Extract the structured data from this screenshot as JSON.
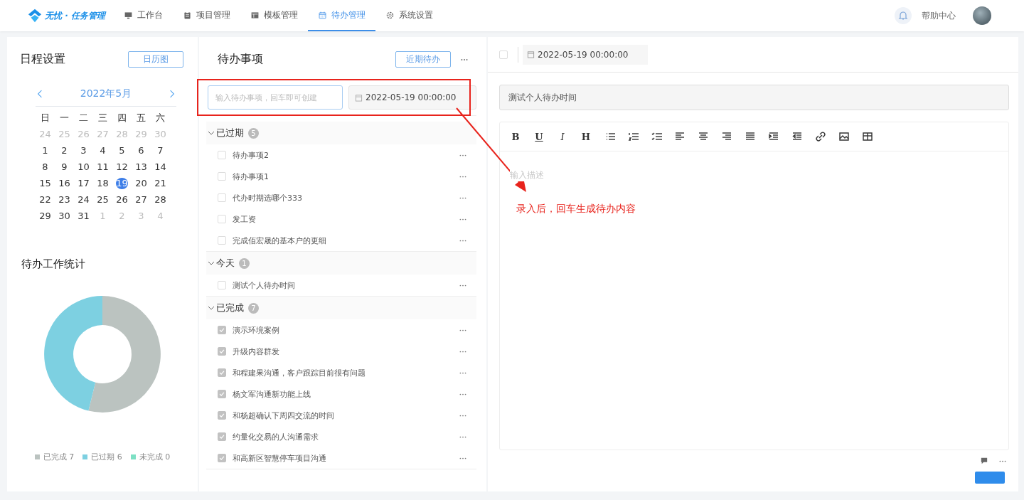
{
  "header": {
    "logo": "无忧 · 任务管理",
    "nav": [
      {
        "label": "工作台",
        "kind": "monitor",
        "selected": false
      },
      {
        "label": "项目管理",
        "kind": "clipboard",
        "selected": false
      },
      {
        "label": "模板管理",
        "kind": "layout",
        "selected": false
      },
      {
        "label": "待办管理",
        "kind": "calendar",
        "selected": true
      },
      {
        "label": "系统设置",
        "kind": "gear",
        "selected": false
      }
    ],
    "help": "帮助中心"
  },
  "schedule": {
    "title": "日程设置",
    "button": "日历图",
    "month": "2022年5月",
    "weekdays": [
      "日",
      "一",
      "二",
      "三",
      "四",
      "五",
      "六"
    ],
    "weeks": [
      [
        {
          "day": "24",
          "other_month": true,
          "selected": false
        },
        {
          "day": "25",
          "other_month": true,
          "selected": false
        },
        {
          "day": "26",
          "other_month": true,
          "selected": false
        },
        {
          "day": "27",
          "other_month": true,
          "selected": false
        },
        {
          "day": "28",
          "other_month": true,
          "selected": false
        },
        {
          "day": "29",
          "other_month": true,
          "selected": false
        },
        {
          "day": "30",
          "other_month": true,
          "selected": false
        }
      ],
      [
        {
          "day": "1",
          "other_month": false,
          "selected": false
        },
        {
          "day": "2",
          "other_month": false,
          "selected": false
        },
        {
          "day": "3",
          "other_month": false,
          "selected": false
        },
        {
          "day": "4",
          "other_month": false,
          "selected": false
        },
        {
          "day": "5",
          "other_month": false,
          "selected": false
        },
        {
          "day": "6",
          "other_month": false,
          "selected": false
        },
        {
          "day": "7",
          "other_month": false,
          "selected": false
        }
      ],
      [
        {
          "day": "8",
          "other_month": false,
          "selected": false
        },
        {
          "day": "9",
          "other_month": false,
          "selected": false
        },
        {
          "day": "10",
          "other_month": false,
          "selected": false
        },
        {
          "day": "11",
          "other_month": false,
          "selected": false
        },
        {
          "day": "12",
          "other_month": false,
          "selected": false
        },
        {
          "day": "13",
          "other_month": false,
          "selected": false
        },
        {
          "day": "14",
          "other_month": false,
          "selected": false
        }
      ],
      [
        {
          "day": "15",
          "other_month": false,
          "selected": false
        },
        {
          "day": "16",
          "other_month": false,
          "selected": false
        },
        {
          "day": "17",
          "other_month": false,
          "selected": false
        },
        {
          "day": "18",
          "other_month": false,
          "selected": false
        },
        {
          "day": "19",
          "other_month": false,
          "selected": true
        },
        {
          "day": "20",
          "other_month": false,
          "selected": false
        },
        {
          "day": "21",
          "other_month": false,
          "selected": false
        }
      ],
      [
        {
          "day": "22",
          "other_month": false,
          "selected": false
        },
        {
          "day": "23",
          "other_month": false,
          "selected": false
        },
        {
          "day": "24",
          "other_month": false,
          "selected": false
        },
        {
          "day": "25",
          "other_month": false,
          "selected": false
        },
        {
          "day": "26",
          "other_month": false,
          "selected": false
        },
        {
          "day": "27",
          "other_month": false,
          "selected": false
        },
        {
          "day": "28",
          "other_month": false,
          "selected": false
        }
      ],
      [
        {
          "day": "29",
          "other_month": false,
          "selected": false
        },
        {
          "day": "30",
          "other_month": false,
          "selected": false
        },
        {
          "day": "31",
          "other_month": false,
          "selected": false
        },
        {
          "day": "1",
          "other_month": true,
          "selected": false
        },
        {
          "day": "2",
          "other_month": true,
          "selected": false
        },
        {
          "day": "3",
          "other_month": true,
          "selected": false
        },
        {
          "day": "4",
          "other_month": true,
          "selected": false
        }
      ]
    ]
  },
  "stats": {
    "title": "待办工作统计",
    "chart_data": {
      "type": "donut",
      "categories": [
        "已完成 7",
        "已过期 6",
        "未完成 0"
      ],
      "values": [
        7,
        6,
        0
      ],
      "colors": [
        "#bbc3c0",
        "#7dd0e1",
        "#7de0c4"
      ]
    }
  },
  "todos": {
    "title": "待办事项",
    "button": "近期待办",
    "input_placeholder": "输入待办事项，回车即可创建",
    "date": "2022-05-19 00:00:00",
    "groups": [
      {
        "label": "已过期",
        "count": "5",
        "expanded": true,
        "items": [
          {
            "text": "待办事项2",
            "checked": false
          },
          {
            "text": "待办事项1",
            "checked": false
          },
          {
            "text": "代办时期选哪个333",
            "checked": false
          },
          {
            "text": "发工资",
            "checked": false
          },
          {
            "text": "完成佰宏晟的基本户的更细",
            "checked": false
          }
        ]
      },
      {
        "label": "今天",
        "count": "1",
        "expanded": true,
        "items": [
          {
            "text": "测试个人待办时间",
            "checked": false
          }
        ]
      },
      {
        "label": "已完成",
        "count": "7",
        "expanded": true,
        "items": [
          {
            "text": "演示环境案例",
            "checked": true
          },
          {
            "text": "升级内容群发",
            "checked": true
          },
          {
            "text": "和程建果沟通，客户跟踪目前很有问题",
            "checked": true
          },
          {
            "text": "杨文军沟通新功能上线",
            "checked": true
          },
          {
            "text": "和杨超确认下周四交流的时间",
            "checked": true
          },
          {
            "text": "约量化交易的人沟通需求",
            "checked": true
          },
          {
            "text": "和高新区智慧停车项目沟通",
            "checked": true
          }
        ]
      }
    ]
  },
  "detail": {
    "checked": false,
    "date": "2022-05-19 00:00:00",
    "title": "测试个人待办时间",
    "description_placeholder": "输入描述",
    "toolbar": [
      {
        "kind": "bold",
        "label": "B"
      },
      {
        "kind": "underline",
        "label": "U"
      },
      {
        "kind": "italic",
        "label": "I"
      },
      {
        "kind": "heading",
        "label": "H"
      },
      {
        "kind": "bullet-list"
      },
      {
        "kind": "numbered-list"
      },
      {
        "kind": "task-list"
      },
      {
        "kind": "align-left"
      },
      {
        "kind": "align-center"
      },
      {
        "kind": "align-right"
      },
      {
        "kind": "justify"
      },
      {
        "kind": "indent"
      },
      {
        "kind": "outdent"
      },
      {
        "kind": "link"
      },
      {
        "kind": "image"
      },
      {
        "kind": "table"
      }
    ]
  },
  "annotation": {
    "text": "录入后，回车生成待办内容"
  }
}
